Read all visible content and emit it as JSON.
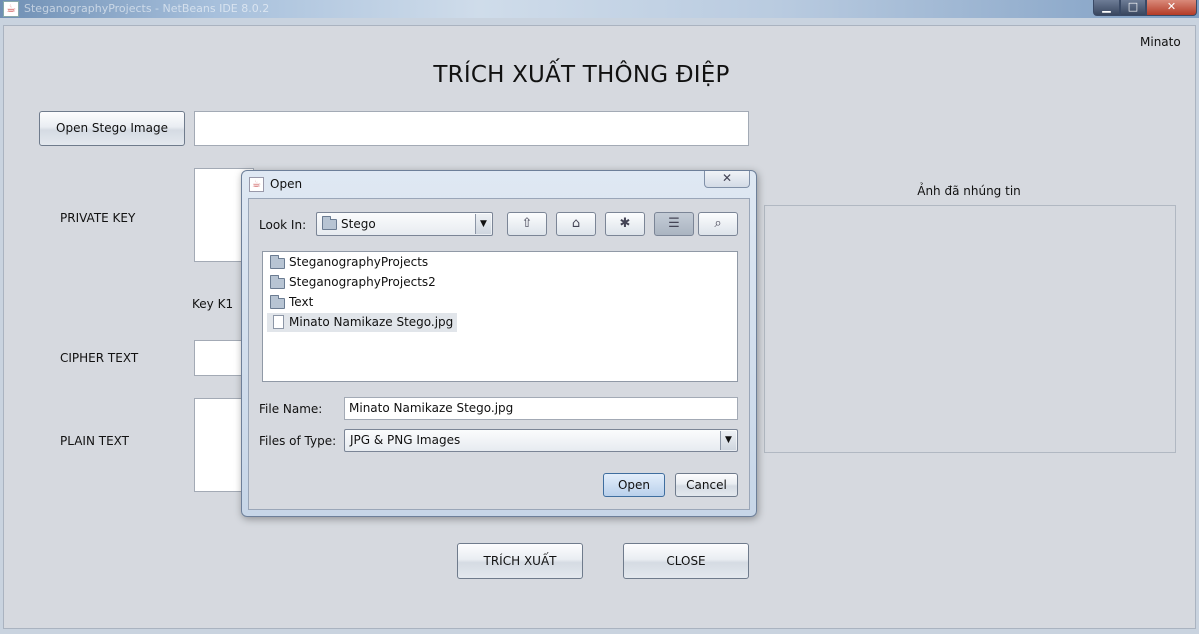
{
  "window": {
    "title": "SteganographyProjects - NetBeans IDE 8.0.2",
    "min_symbol": "▁",
    "max_symbol": "□",
    "close_symbol": "✕"
  },
  "app": {
    "user": "Minato",
    "title": "TRÍCH XUẤT THÔNG ĐIỆP",
    "open_stego_label": "Open Stego Image",
    "stego_path": "",
    "private_key_label": "PRIVATE KEY",
    "key_k1_label": "Key K1",
    "cipher_text_label": "CIPHER TEXT",
    "plain_text_label": "PLAIN TEXT",
    "image_label": "Ảnh đã nhúng tin",
    "extract_label": "TRÍCH XUẤT",
    "close_label": "CLOSE"
  },
  "dialog": {
    "title": "Open",
    "close_symbol": "✕",
    "look_in_label": "Look In:",
    "look_in_value": "Stego",
    "toolbar_icons": [
      "up-folder-icon",
      "home-icon",
      "new-folder-icon",
      "list-view-icon",
      "details-view-icon"
    ],
    "files": [
      {
        "name": "SteganographyProjects",
        "type": "folder"
      },
      {
        "name": "SteganographyProjects2",
        "type": "folder"
      },
      {
        "name": "Text",
        "type": "folder"
      },
      {
        "name": "Minato Namikaze Stego.jpg",
        "type": "file",
        "selected": true
      }
    ],
    "file_name_label": "File Name:",
    "file_name_value": "Minato Namikaze Stego.jpg",
    "files_of_type_label": "Files of Type:",
    "files_of_type_value": "JPG & PNG Images",
    "open_label": "Open",
    "cancel_label": "Cancel"
  }
}
